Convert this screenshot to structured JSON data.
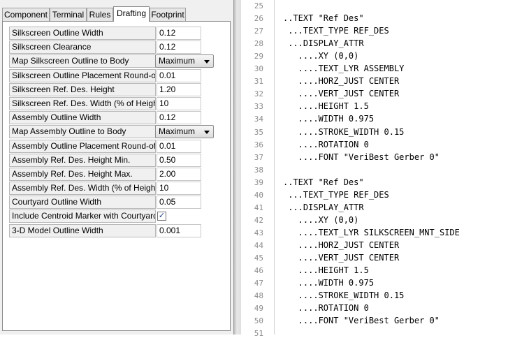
{
  "tabs": [
    {
      "label": "Component"
    },
    {
      "label": "Terminal"
    },
    {
      "label": "Rules"
    },
    {
      "label": "Drafting"
    },
    {
      "label": "Footprint"
    }
  ],
  "active_tab": "Drafting",
  "properties": [
    {
      "label": "Silkscreen Outline Width",
      "value": "0.12",
      "kind": "text"
    },
    {
      "label": "Silkscreen Clearance",
      "value": "0.12",
      "kind": "text"
    },
    {
      "label": "Map Silkscreen Outline to Body",
      "value": "Maximum",
      "kind": "select"
    },
    {
      "label": "Silkscreen Outline Placement Round-off",
      "value": "0.01",
      "kind": "text"
    },
    {
      "label": "Silkscreen Ref. Des. Height",
      "value": "1.20",
      "kind": "text"
    },
    {
      "label": "Silkscreen Ref. Des. Width (% of Height)",
      "value": "10",
      "kind": "text"
    },
    {
      "label": "Assembly Outline Width",
      "value": "0.12",
      "kind": "text"
    },
    {
      "label": "Map Assembly Outline to Body",
      "value": "Maximum",
      "kind": "select"
    },
    {
      "label": "Assembly Outline Placement Round-off",
      "value": "0.01",
      "kind": "text"
    },
    {
      "label": "Assembly Ref. Des.  Height Min.",
      "value": "0.50",
      "kind": "text"
    },
    {
      "label": "Assembly Ref. Des. Height Max.",
      "value": "2.00",
      "kind": "text"
    },
    {
      "label": "Assembly Ref. Des. Width (% of Height)",
      "value": "10",
      "kind": "text"
    },
    {
      "label": "Courtyard Outline Width",
      "value": "0.05",
      "kind": "text"
    },
    {
      "label": "Include Centroid Marker with Courtyard",
      "value": "✓",
      "kind": "checkbox"
    },
    {
      "label": "3-D Model Outline Width",
      "value": "0.001",
      "kind": "text"
    }
  ],
  "editor": {
    "lines": [
      {
        "n": "25",
        "text": ""
      },
      {
        "n": "26",
        "text": "..TEXT \"Ref Des\""
      },
      {
        "n": "27",
        "text": " ...TEXT_TYPE REF_DES"
      },
      {
        "n": "28",
        "text": " ...DISPLAY_ATTR"
      },
      {
        "n": "29",
        "text": "   ....XY (0,0)"
      },
      {
        "n": "30",
        "text": "   ....TEXT_LYR ASSEMBLY"
      },
      {
        "n": "31",
        "text": "   ....HORZ_JUST CENTER"
      },
      {
        "n": "32",
        "text": "   ....VERT_JUST CENTER"
      },
      {
        "n": "33",
        "text": "   ....HEIGHT 1.5"
      },
      {
        "n": "34",
        "text": "   ....WIDTH 0.975"
      },
      {
        "n": "35",
        "text": "   ....STROKE_WIDTH 0.15"
      },
      {
        "n": "36",
        "text": "   ....ROTATION 0"
      },
      {
        "n": "37",
        "text": "   ....FONT \"VeriBest Gerber 0\""
      },
      {
        "n": "38",
        "text": ""
      },
      {
        "n": "39",
        "text": "..TEXT \"Ref Des\""
      },
      {
        "n": "40",
        "text": " ...TEXT_TYPE REF_DES"
      },
      {
        "n": "41",
        "text": " ...DISPLAY_ATTR"
      },
      {
        "n": "42",
        "text": "   ....XY (0,0)"
      },
      {
        "n": "43",
        "text": "   ....TEXT_LYR SILKSCREEN_MNT_SIDE"
      },
      {
        "n": "44",
        "text": "   ....HORZ_JUST CENTER"
      },
      {
        "n": "45",
        "text": "   ....VERT_JUST CENTER"
      },
      {
        "n": "46",
        "text": "   ....HEIGHT 1.5"
      },
      {
        "n": "47",
        "text": "   ....WIDTH 0.975"
      },
      {
        "n": "48",
        "text": "   ....STROKE_WIDTH 0.15"
      },
      {
        "n": "49",
        "text": "   ....ROTATION 0"
      },
      {
        "n": "50",
        "text": "   ....FONT \"VeriBest Gerber 0\""
      },
      {
        "n": "51",
        "text": ""
      }
    ]
  }
}
